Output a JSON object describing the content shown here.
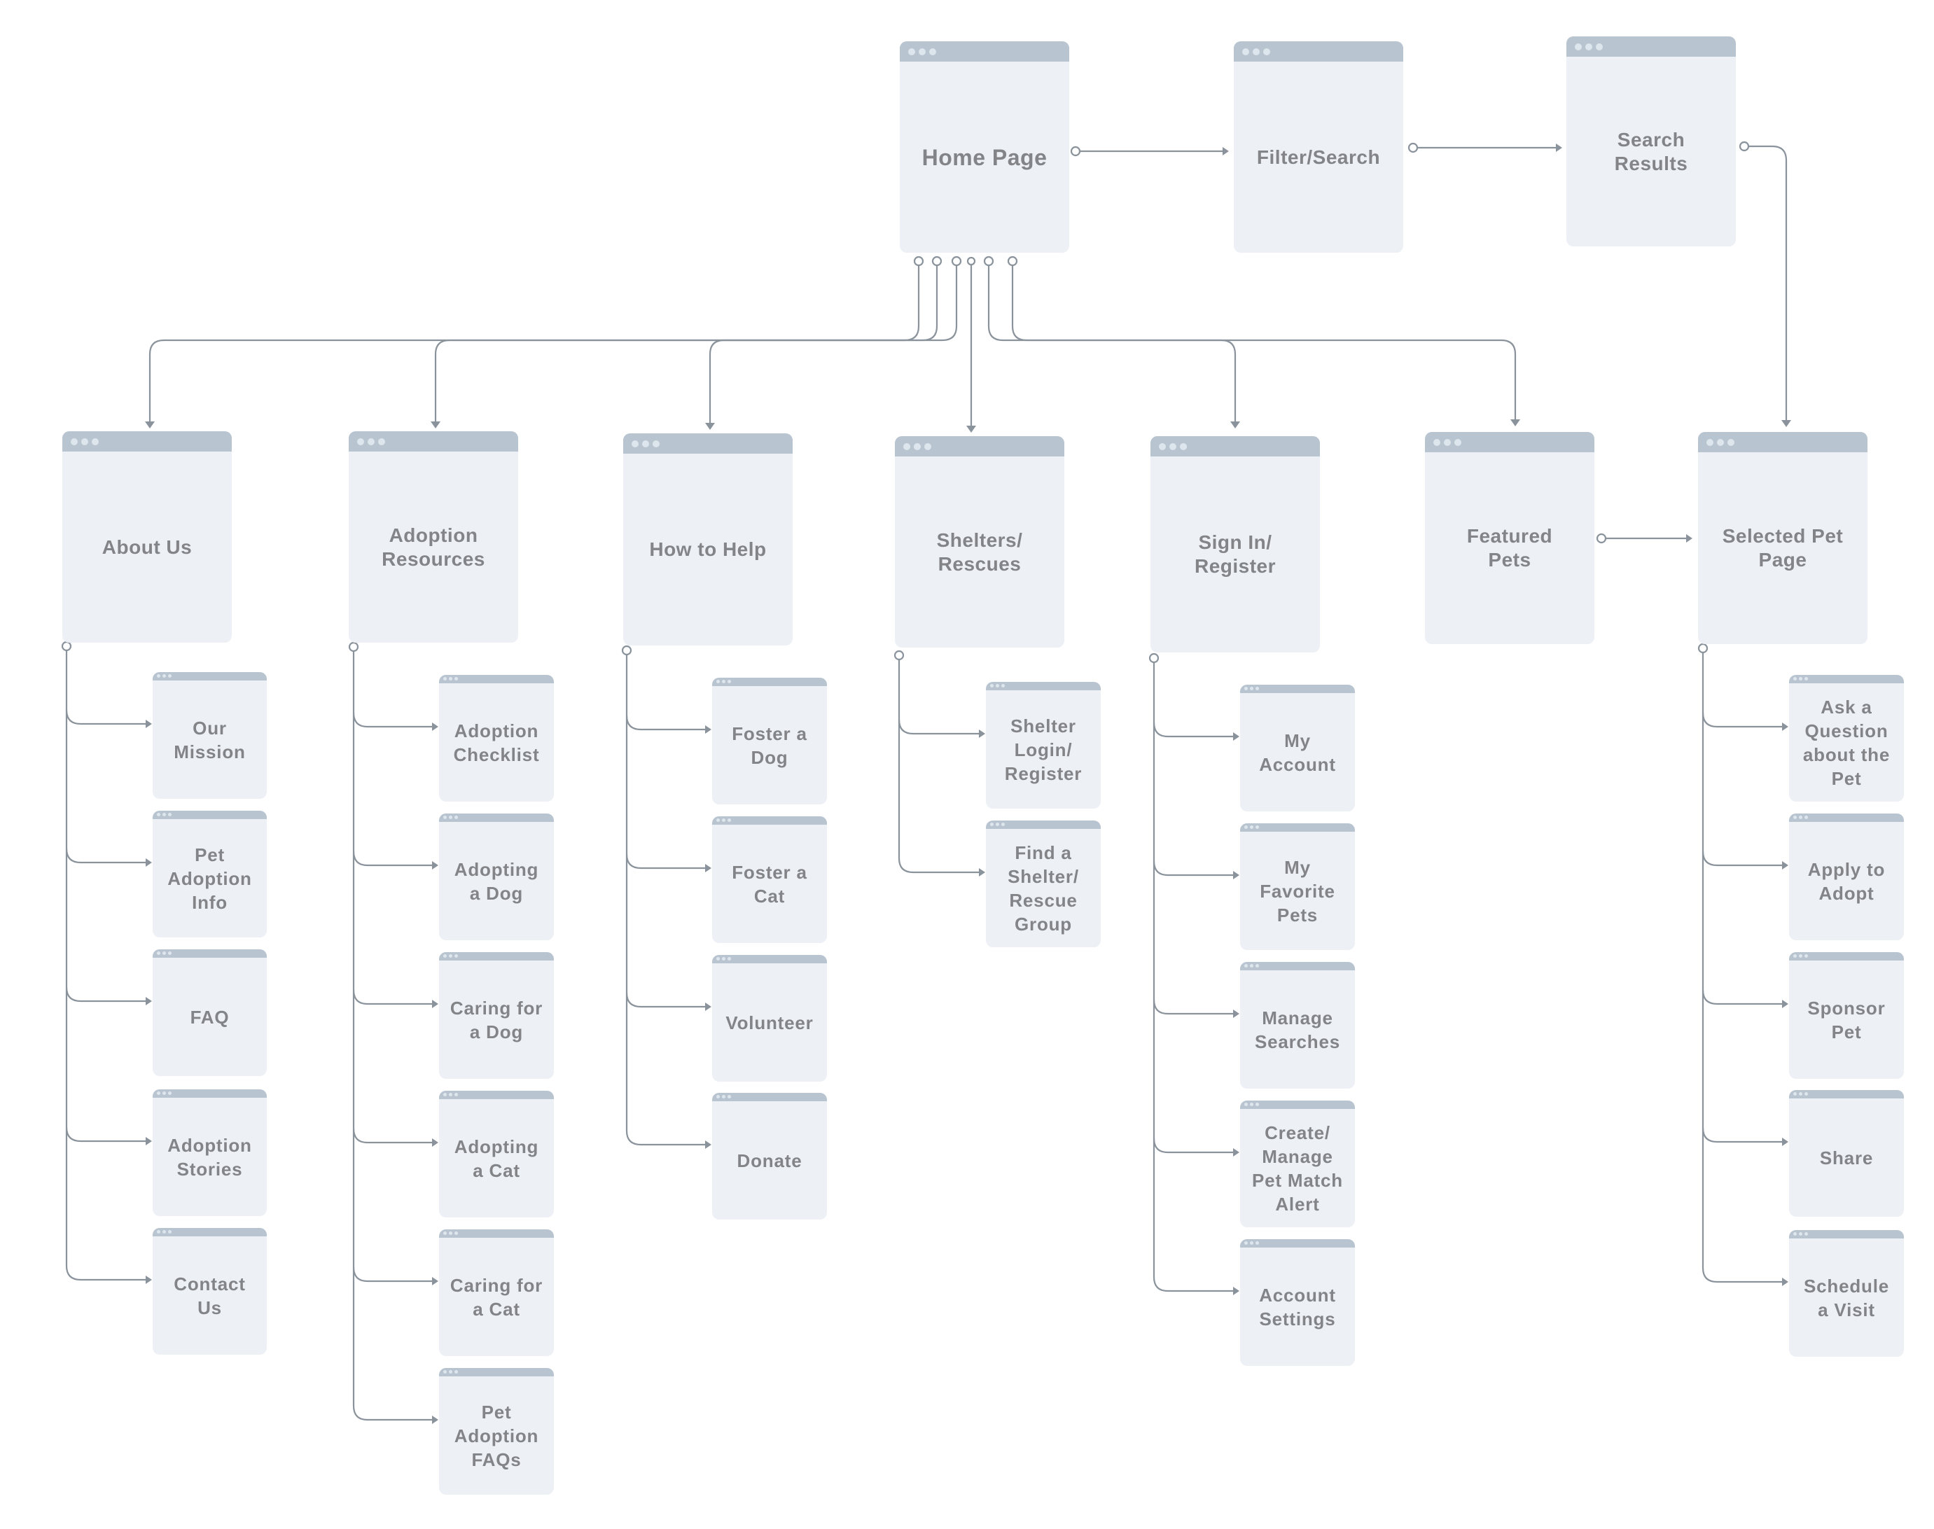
{
  "colors": {
    "page_body": "#edf0f5",
    "page_bar": "#b8c4cf",
    "page_dots": "#dde5ed",
    "label_text": "#838487",
    "connector": "#8a939b"
  },
  "top_flow": [
    {
      "id": "home",
      "label": "Home Page"
    },
    {
      "id": "filter",
      "label": "Filter/Search"
    },
    {
      "id": "results",
      "label": "Search\nResults"
    }
  ],
  "sections": [
    {
      "id": "about",
      "label": "About Us",
      "children": [
        "Our\nMission",
        "Pet\nAdoption\nInfo",
        "FAQ",
        "Adoption\nStories",
        "Contact\nUs"
      ]
    },
    {
      "id": "resources",
      "label": "Adoption\nResources",
      "children": [
        "Adoption\nChecklist",
        "Adopting\na Dog",
        "Caring for\na Dog",
        "Adopting\na Cat",
        "Caring for\na Cat",
        "Pet\nAdoption\nFAQs"
      ]
    },
    {
      "id": "help",
      "label": "How to Help",
      "children": [
        "Foster a\nDog",
        "Foster a\nCat",
        "Volunteer",
        "Donate"
      ]
    },
    {
      "id": "shelters",
      "label": "Shelters/\nRescues",
      "children": [
        "Shelter\nLogin/\nRegister",
        "Find a\nShelter/\nRescue\nGroup"
      ]
    },
    {
      "id": "signin",
      "label": "Sign In/\nRegister",
      "children": [
        "My\nAccount",
        "My\nFavorite\nPets",
        "Manage\nSearches",
        "Create/\nManage\nPet Match\nAlert",
        "Account\nSettings"
      ]
    },
    {
      "id": "featured",
      "label": "Featured\nPets",
      "children": []
    },
    {
      "id": "selected",
      "label": "Selected Pet\nPage",
      "children": [
        "Ask a\nQuestion\nabout the\nPet",
        "Apply to\nAdopt",
        "Sponsor\nPet",
        "Share",
        "Schedule\na Visit"
      ]
    }
  ]
}
